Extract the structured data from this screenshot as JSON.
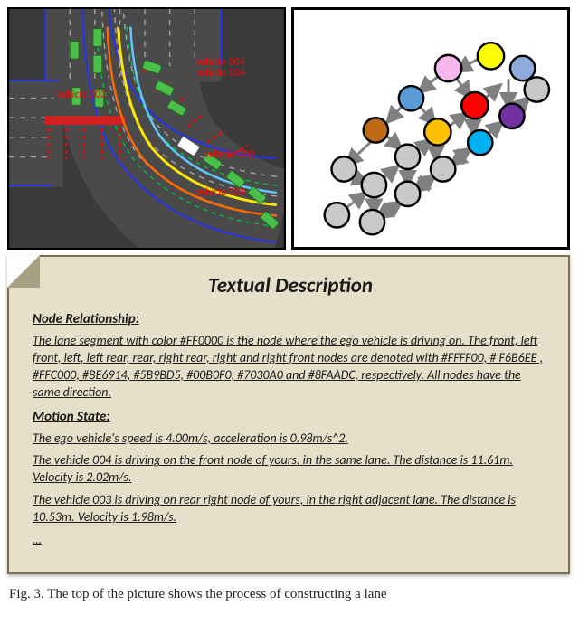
{
  "labels": {
    "vehicle003": "vehicle 003",
    "vehicle004": "vehicle 004",
    "vehicle000": "vehicle 000",
    "vehicle001": "vehicle 001"
  },
  "graph": {
    "node_colors": {
      "ego": "#FF0000",
      "front": "#FFFF00",
      "left_front": "#F6B6EE",
      "left": "#FFC000",
      "left_rear": "#BE6914",
      "rear": "#5B9BD5",
      "right_rear": "#00B0F0",
      "right": "#7030A0",
      "right_front": "#8FAADC",
      "neutral": "#C9C9C9"
    }
  },
  "description": {
    "title": "Textual Description",
    "section_relationship": "Node Relationship:",
    "relationship_text": "The lane segment with color #FF0000 is the node where the ego vehicle is driving on. The front, left front, left,  left rear, rear, right rear, right and right front nodes are denoted with #FFFF00, # F6B6EE , #FFC000, #BE6914, #5B9BD5, #00B0F0, #7030A0 and #8FAADC, respectively.  All nodes have the same direction.",
    "section_motion": "Motion State:",
    "motion_lines": [
      "The ego vehicle's speed is 4.00m/s, acceleration is 0.98m/s^2.",
      "The vehicle  004 is driving on the front node of yours, in the same lane. The distance is 11.61m. Velocity is 2.02m/s.",
      "The vehicle  003 is driving on rear right node of yours, in the right adjacent lane. The distance is 10.53m. Velocity is 1.98m/s.",
      "…"
    ]
  },
  "caption": "Fig. 3.   The top of the picture shows the process of constructing a lane"
}
